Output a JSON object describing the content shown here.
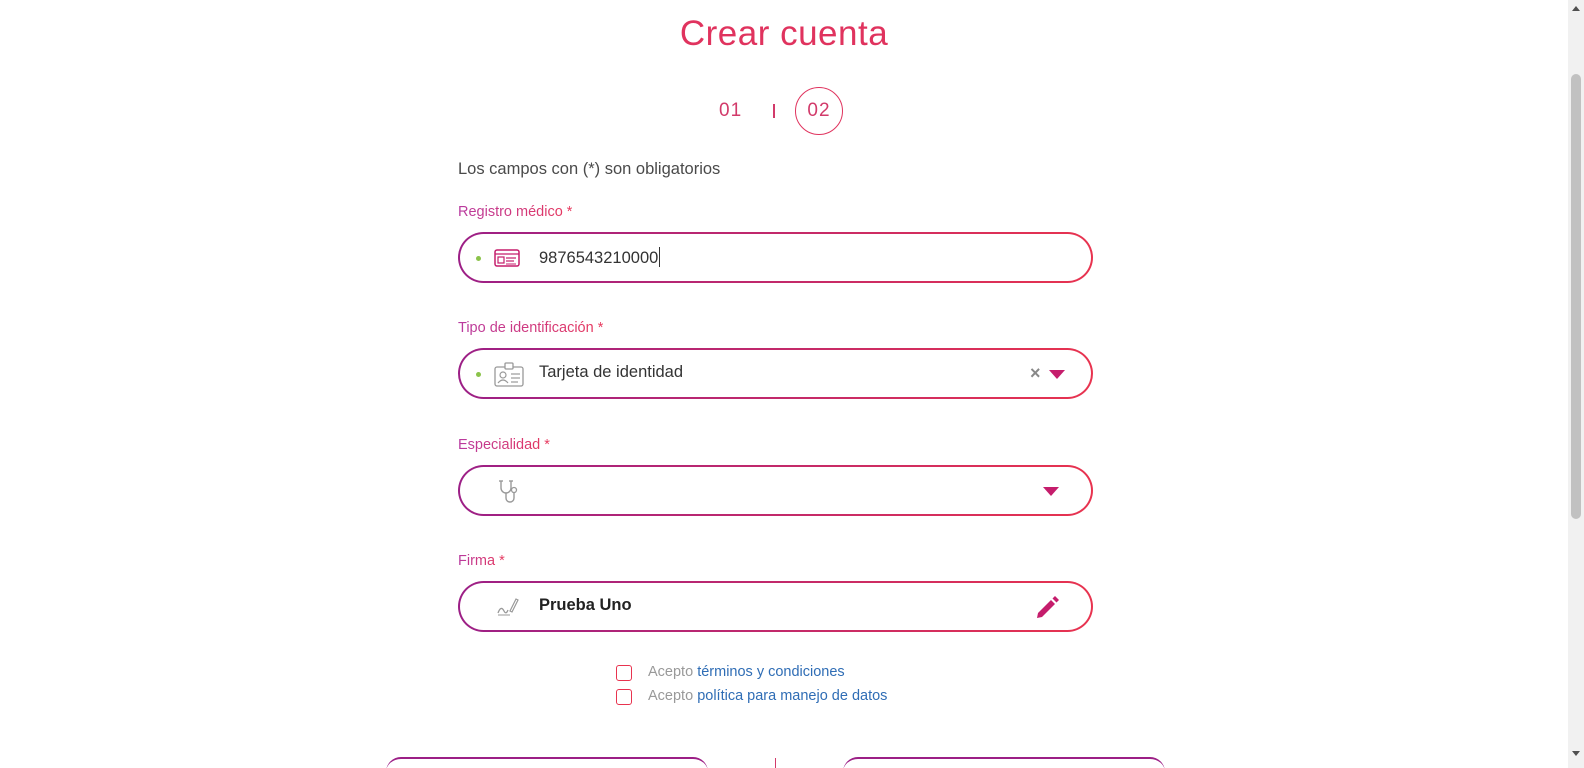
{
  "title": "Crear cuenta",
  "steps": {
    "step1": "01",
    "step2": "02",
    "active": "02"
  },
  "required_note": "Los campos con (*) son obligatorios",
  "fields": {
    "registro": {
      "label": "Registro médico *",
      "value": "9876543210000",
      "icon": "id-card-icon"
    },
    "tipo_id": {
      "label": "Tipo de identificación *",
      "value": "Tarjeta de identidad",
      "icon": "badge-icon"
    },
    "especialidad": {
      "label": "Especialidad *",
      "value": "",
      "icon": "stethoscope-icon"
    },
    "firma": {
      "label": "Firma *",
      "value": "Prueba Uno",
      "icon": "signature-icon"
    }
  },
  "checks": [
    {
      "prefix": "Acepto",
      "link": "términos y condiciones"
    },
    {
      "prefix": "Acepto",
      "link": "política para manejo de datos"
    }
  ],
  "colors": {
    "accent": "#e0335e",
    "gradient_start": "#9c1f86",
    "gradient_end": "#e8334f",
    "link": "#2f6db5",
    "valid_dot": "#8bc34a"
  }
}
